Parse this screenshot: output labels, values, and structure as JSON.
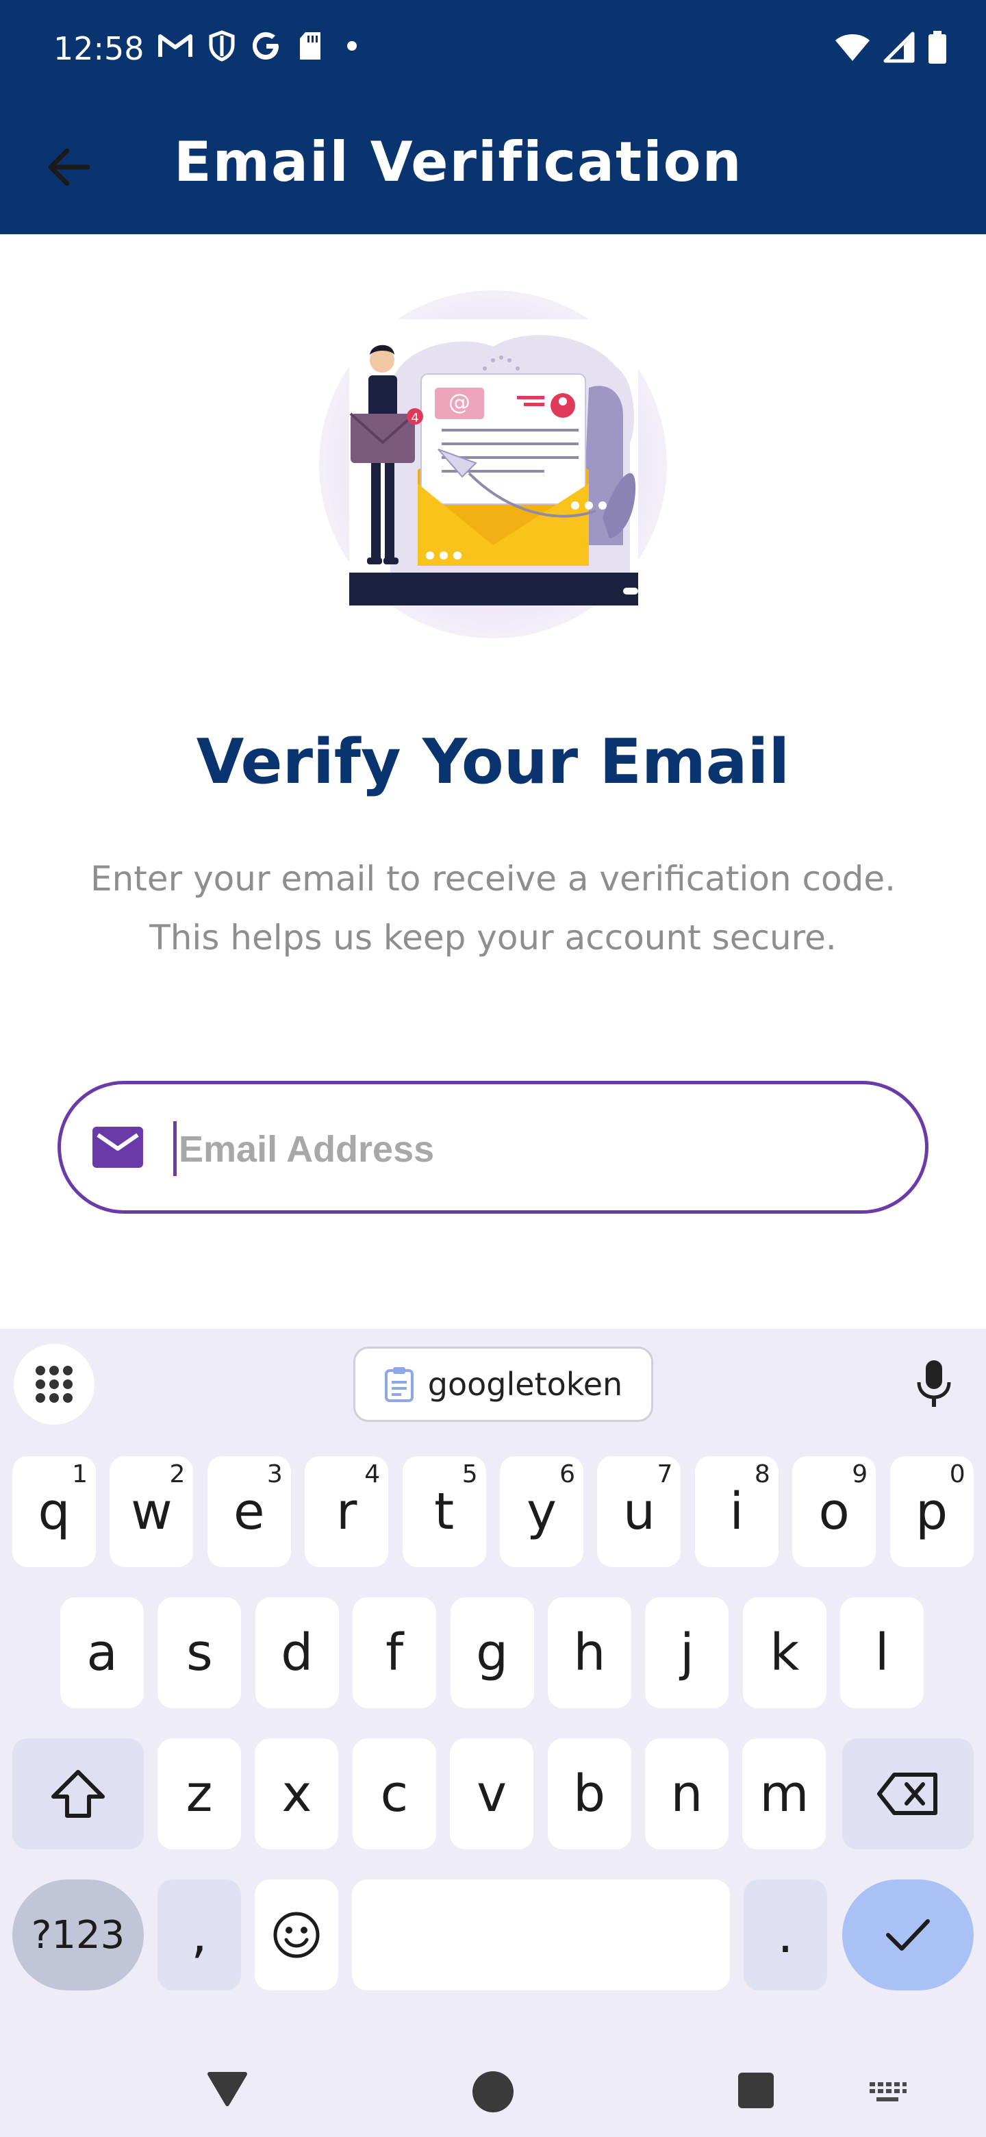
{
  "status_bar": {
    "time": "12:58",
    "left_icons": [
      "gmail-icon",
      "shield-icon",
      "google-icon",
      "sd-card-icon",
      "dot-icon"
    ],
    "right_icons": [
      "wifi-icon",
      "signal-icon",
      "battery-icon"
    ]
  },
  "app_bar": {
    "title": "Email Verification",
    "back_icon": "arrow-left-icon",
    "color": "#0a3470"
  },
  "content": {
    "heading": "Verify Your Email",
    "subtext_line1": "Enter your email to receive a verification code.",
    "subtext_line2": "This helps us keep your account secure.",
    "email_field": {
      "placeholder": "Email Address",
      "value": "",
      "icon": "mail-icon",
      "border_color": "#6a3aa8"
    }
  },
  "keyboard": {
    "suggestion_chip": "googletoken",
    "row1": [
      {
        "label": "q",
        "hint": "1"
      },
      {
        "label": "w",
        "hint": "2"
      },
      {
        "label": "e",
        "hint": "3"
      },
      {
        "label": "r",
        "hint": "4"
      },
      {
        "label": "t",
        "hint": "5"
      },
      {
        "label": "y",
        "hint": "6"
      },
      {
        "label": "u",
        "hint": "7"
      },
      {
        "label": "i",
        "hint": "8"
      },
      {
        "label": "o",
        "hint": "9"
      },
      {
        "label": "p",
        "hint": "0"
      }
    ],
    "row2": [
      "a",
      "s",
      "d",
      "f",
      "g",
      "h",
      "j",
      "k",
      "l"
    ],
    "row3": [
      "z",
      "x",
      "c",
      "v",
      "b",
      "n",
      "m"
    ],
    "symbols_label": "?123",
    "comma_label": ",",
    "period_label": "."
  }
}
